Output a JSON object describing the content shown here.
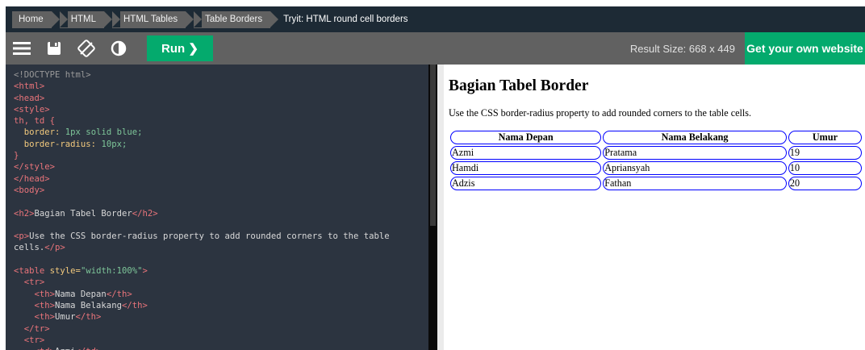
{
  "breadcrumb": {
    "items": [
      "Home",
      "HTML",
      "HTML Tables",
      "Table Borders"
    ],
    "current": "Tryit: HTML round cell borders"
  },
  "toolbar": {
    "icons": [
      "menu-icon",
      "save-icon",
      "rotate-icon",
      "contrast-icon"
    ],
    "run_label": "Run ❯",
    "result_size": "Result Size: 668 x 449",
    "get_website_label": "Get your own website",
    "accent": "#04aa6d"
  },
  "code": {
    "lines": [
      "<!DOCTYPE html>",
      "<html>",
      "<head>",
      "<style>",
      "th, td {",
      "  border: 1px solid blue;",
      "  border-radius: 10px;",
      "}",
      "</style>",
      "</head>",
      "<body>",
      "",
      "<h2>Bagian Tabel Border</h2>",
      "",
      "<p>Use the CSS border-radius property to add rounded corners to the table",
      "cells.</p>",
      "",
      "<table style=\"width:100%\">",
      "  <tr>",
      "    <th>Nama Depan</th>",
      "    <th>Nama Belakang</th>",
      "    <th>Umur</th>",
      "  </tr>",
      "  <tr>",
      "    <td>Azmi</td>"
    ]
  },
  "result": {
    "heading": "Bagian Tabel Border",
    "paragraph": "Use the CSS border-radius property to add rounded corners to the table cells.",
    "table": {
      "headers": [
        "Nama Depan",
        "Nama Belakang",
        "Umur"
      ],
      "rows": [
        [
          "Azmi",
          "Pratama",
          "19"
        ],
        [
          "Hamdi",
          "Apriansyah",
          "10"
        ],
        [
          "Adzis",
          "Fathan",
          "20"
        ]
      ]
    }
  }
}
